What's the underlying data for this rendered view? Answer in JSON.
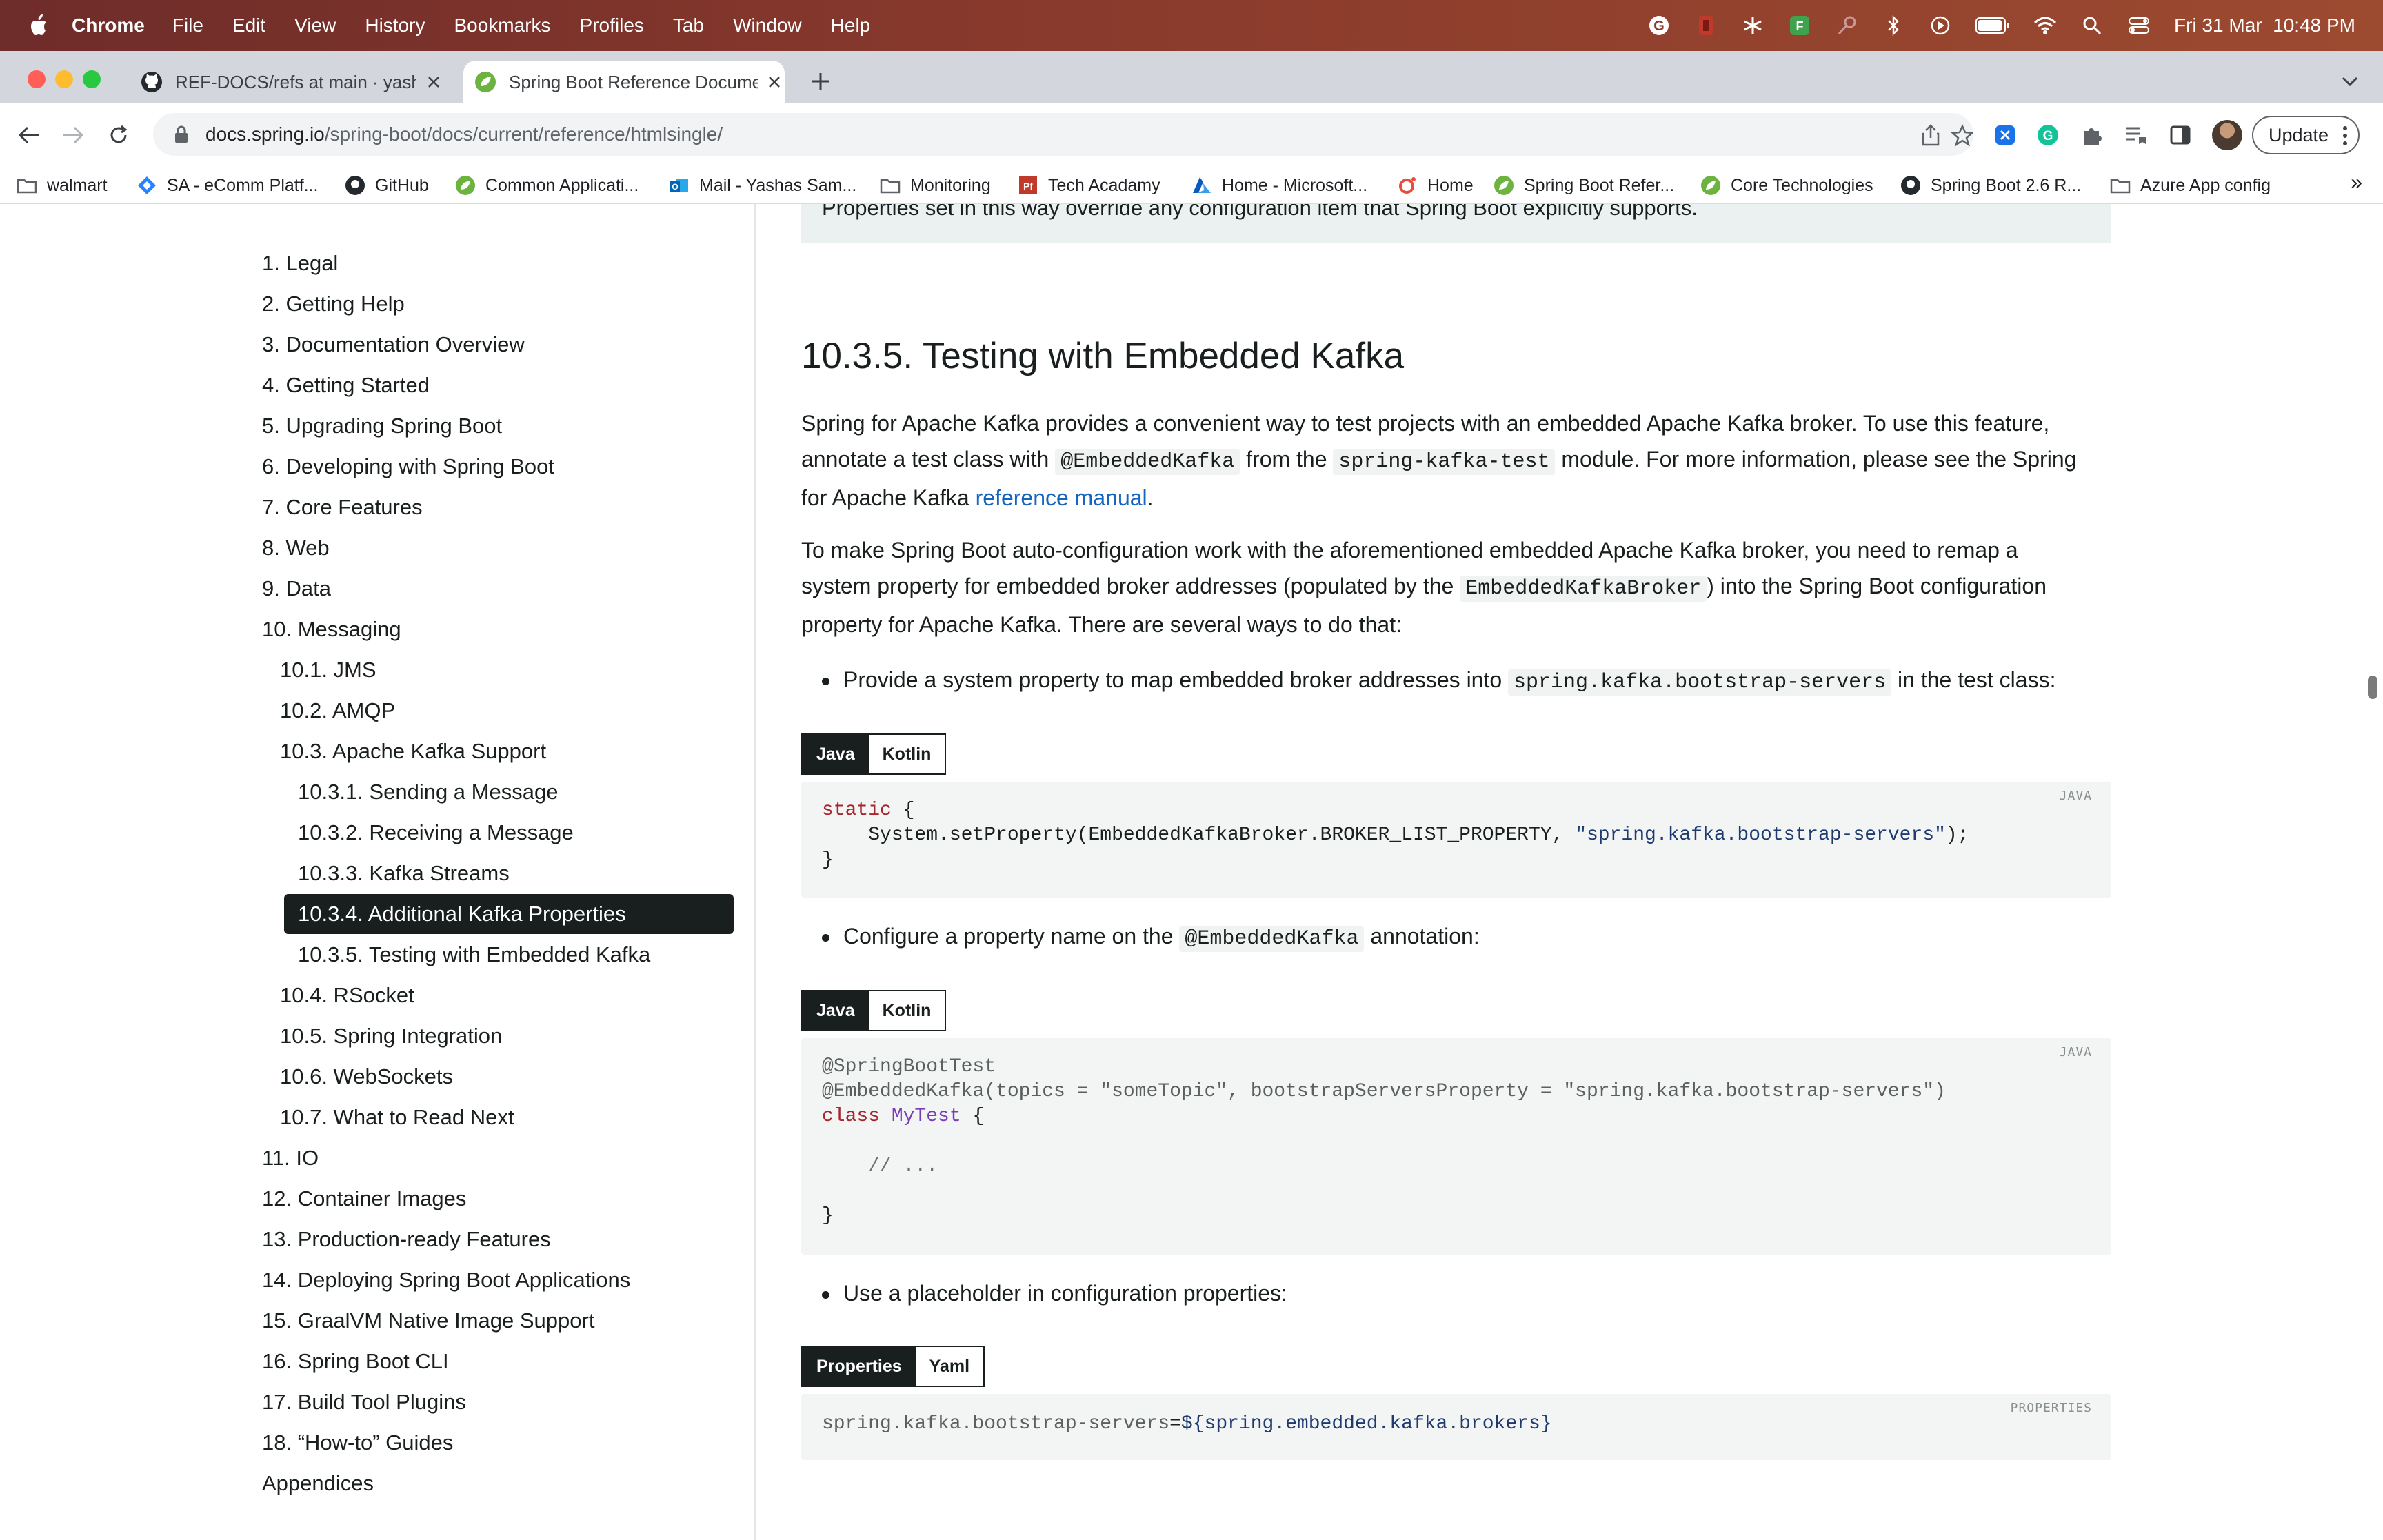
{
  "menubar": {
    "app": "Chrome",
    "items": [
      "File",
      "Edit",
      "View",
      "History",
      "Bookmarks",
      "Profiles",
      "Tab",
      "Window",
      "Help"
    ],
    "datetime": "Fri 31 Mar  10:48 PM"
  },
  "tabs": [
    {
      "title": "REF-DOCS/refs at main · yasha",
      "favicon": "github-icon",
      "active": false
    },
    {
      "title": "Spring Boot Reference Documentation",
      "favicon": "spring-icon",
      "active": true
    }
  ],
  "address": {
    "host": "docs.spring.io",
    "path": "/spring-boot/docs/current/reference/htmlsingle/"
  },
  "toolbar": {
    "update_label": "Update"
  },
  "bookmarks": [
    {
      "label": "walmart",
      "icon": "folder-icon"
    },
    {
      "label": "SA - eComm Platf...",
      "icon": "jira-icon"
    },
    {
      "label": "GitHub",
      "icon": "github-icon"
    },
    {
      "label": "Common Applicati...",
      "icon": "spring-icon"
    },
    {
      "label": "Mail - Yashas Sam...",
      "icon": "outlook-icon"
    },
    {
      "label": "Monitoring",
      "icon": "folder-icon"
    },
    {
      "label": "Tech Acadamy",
      "icon": "pf-icon"
    },
    {
      "label": "Home - Microsoft...",
      "icon": "azure-icon"
    },
    {
      "label": "Home",
      "icon": "o-icon"
    },
    {
      "label": "Spring Boot Refer...",
      "icon": "spring-icon"
    },
    {
      "label": "Core Technologies",
      "icon": "spring-icon"
    },
    {
      "label": "Spring Boot 2.6 R...",
      "icon": "github-icon"
    },
    {
      "label": "Azure App config",
      "icon": "folder-icon"
    }
  ],
  "toc": [
    "1. Legal",
    "2. Getting Help",
    "3. Documentation Overview",
    "4. Getting Started",
    "5. Upgrading Spring Boot",
    "6. Developing with Spring Boot",
    "7. Core Features",
    "8. Web",
    "9. Data",
    "10. Messaging",
    "10.1. JMS",
    "10.2. AMQP",
    "10.3. Apache Kafka Support",
    "10.3.1. Sending a Message",
    "10.3.2. Receiving a Message",
    "10.3.3. Kafka Streams",
    "10.3.4. Additional Kafka Properties",
    "10.3.5. Testing with Embedded Kafka",
    "10.4. RSocket",
    "10.5. Spring Integration",
    "10.6. WebSockets",
    "10.7. What to Read Next",
    "11. IO",
    "12. Container Images",
    "13. Production-ready Features",
    "14. Deploying Spring Boot Applications",
    "15. GraalVM Native Image Support",
    "16. Spring Boot CLI",
    "17. Build Tool Plugins",
    "18. “How-to” Guides",
    "Appendices"
  ],
  "toc_active": "10.3.4. Additional Kafka Properties",
  "content": {
    "note": "Properties set in this way override any configuration item that Spring Boot explicitly supports.",
    "heading": "10.3.5. Testing with Embedded Kafka",
    "p1_l1": "Spring for Apache Kafka provides a convenient way to test projects with an embedded Apache Kafka broker. To use this feature,",
    "p1_l2a": "annotate a test class with ",
    "p1_code1": "@EmbeddedKafka",
    "p1_l2b": " from the ",
    "p1_code2": "spring-kafka-test",
    "p1_l2c": " module. For more information, please see the Spring",
    "p1_l3a": "for Apache Kafka ",
    "p1_link": "reference manual",
    "p1_l3b": ".",
    "p2_l1": "To make Spring Boot auto-configuration work with the aforementioned embedded Apache Kafka broker, you need to remap a",
    "p2_l2a": "system property for embedded broker addresses (populated by the ",
    "p2_code": "EmbeddedKafkaBroker",
    "p2_l2b": ") into the Spring Boot configuration",
    "p2_l3": "property for Apache Kafka. There are several ways to do that:",
    "b1a": "Provide a system property to map embedded broker addresses into ",
    "b1_code": "spring.kafka.bootstrap-servers",
    "b1b": " in the test class:",
    "b2a": "Configure a property name on the ",
    "b2_code": "@EmbeddedKafka",
    "b2b": " annotation:",
    "b3": "Use a placeholder in configuration properties:",
    "tabs_java": "Java",
    "tabs_kotlin": "Kotlin",
    "tabs_props": "Properties",
    "tabs_yaml": "Yaml",
    "lang_java": "JAVA",
    "lang_props": "PROPERTIES",
    "code1": {
      "l1_kw": "static",
      "l1_rest": " {",
      "l2_a": "    System.setProperty(EmbeddedKafkaBroker.BROKER_LIST_PROPERTY, ",
      "l2_str": "\"spring.kafka.bootstrap-servers\"",
      "l2_b": ");",
      "l3": "}"
    },
    "code2": {
      "l1": "@SpringBootTest",
      "l2": "@EmbeddedKafka(topics = \"someTopic\", bootstrapServersProperty = \"spring.kafka.bootstrap-servers\")",
      "l3_kw": "class",
      "l3_name": " MyTest",
      "l3_rest": " {",
      "l4": "    // ...",
      "l5": "}"
    },
    "code3": {
      "key": "spring.kafka.bootstrap-servers",
      "eq": "=",
      "val": "${spring.embedded.kafka.brokers}"
    }
  }
}
